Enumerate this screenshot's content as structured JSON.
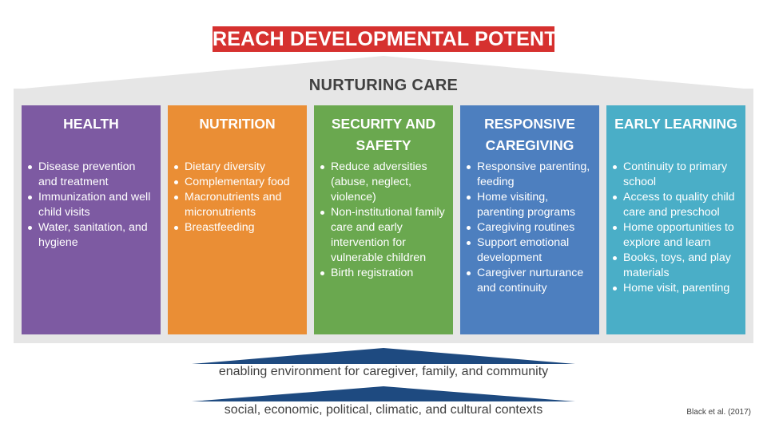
{
  "title": "REACH DEVELOPMENTAL POTENTIAL",
  "subtitle": "NURTURING CARE",
  "pillars": [
    {
      "heading": "HEALTH",
      "color": "#7d5aa2",
      "items": [
        "Disease prevention and treatment",
        "Immunization and well child visits",
        "Water, sanitation, and hygiene"
      ]
    },
    {
      "heading": "NUTRITION",
      "color": "#ea8e35",
      "items": [
        "Dietary diversity",
        "Complementary food",
        "Macronutrients and micronutrients",
        "Breastfeeding"
      ]
    },
    {
      "heading": "SECURITY AND SAFETY",
      "color": "#6aa84f",
      "items": [
        "Reduce adversities (abuse, neglect, violence)",
        "Non-institutional family care and early intervention for vulnerable children",
        "Birth registration"
      ]
    },
    {
      "heading": "RESPONSIVE CAREGIVING",
      "color": "#4d7fbf",
      "items": [
        "Responsive parenting, feeding",
        "Home visiting, parenting programs",
        "Caregiving routines",
        "Support emotional development",
        "Caregiver nurturance and continuity"
      ]
    },
    {
      "heading": "EARLY LEARNING",
      "color": "#4aaec7",
      "items": [
        "Continuity to primary school",
        "Access to quality child care and preschool",
        "Home opportunities to explore and learn",
        "Books, toys, and play materials",
        "Home visit, parenting"
      ]
    }
  ],
  "foundation": [
    "enabling environment for caregiver, family, and community",
    "social, economic, political, climatic, and cultural contexts"
  ],
  "citation": "Black et al. (2017)",
  "colors": {
    "title_bg": "#d6312f",
    "roof": "#e6e6e6",
    "foundation": "#1e4a80",
    "text": "#404040"
  }
}
